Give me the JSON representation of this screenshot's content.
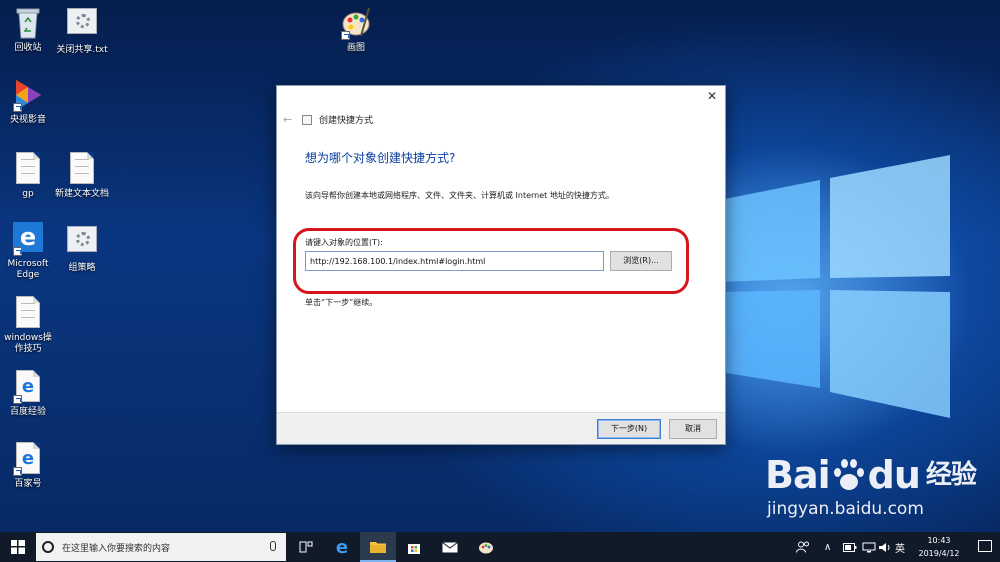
{
  "desktop": {
    "icons": [
      {
        "label": "回收站",
        "icon": "recycle-bin-icon"
      },
      {
        "label": "关闭共享.txt",
        "icon": "settings-file-icon"
      },
      {
        "label": "画图",
        "icon": "paint-icon"
      },
      {
        "label": "央视影音",
        "icon": "video-player-icon"
      },
      {
        "label": "gp",
        "icon": "document-icon"
      },
      {
        "label": "新建文本文档",
        "icon": "document-icon"
      },
      {
        "label": "Microsoft Edge",
        "icon": "edge-icon"
      },
      {
        "label": "组策略",
        "icon": "settings-file-icon"
      },
      {
        "label": "windows操作技巧",
        "icon": "document-icon"
      },
      {
        "label": "百度经验",
        "icon": "ie-icon"
      },
      {
        "label": "百家号",
        "icon": "ie-icon"
      }
    ]
  },
  "dialog": {
    "title": "创建快捷方式",
    "heading": "想为哪个对象创建快捷方式?",
    "description": "该向导帮你创建本地或网络程序、文件、文件夹、计算机或 Internet 地址的快捷方式。",
    "location_label": "请键入对象的位置(T):",
    "location_value": "http://192.168.100.1/index.html#login.html",
    "browse_label": "浏览(R)...",
    "hint": "单击“下一步”继续。",
    "next_label": "下一步(N)",
    "cancel_label": "取消",
    "highlight_color": "#d4161a"
  },
  "taskbar": {
    "search_placeholder": "在这里输入你要搜索的内容",
    "apps": [
      "task-view-icon",
      "edge-icon",
      "file-explorer-icon",
      "store-icon",
      "mail-icon",
      "paint-icon"
    ],
    "ime": "英",
    "time": "10:43",
    "date": "2019/4/12"
  },
  "watermark": {
    "logo_left": "Bai",
    "logo_right": "du",
    "logo_cn": "经验",
    "url": "jingyan.baidu.com"
  }
}
